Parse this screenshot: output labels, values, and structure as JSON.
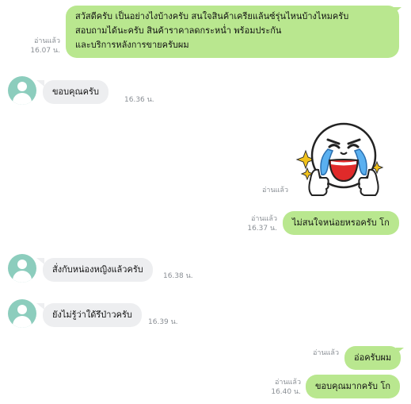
{
  "messages": {
    "m1": {
      "line1": "สวัสดีครับ เป็นอย่างไงบ้างครับ สนใจสินค้าเครียแล้นซ์รุ่นไหนบ้างไหมครับ",
      "line2": "สอบถามได้นะครับ สินค้าราคาลดกระหน่ำ พร้อมประกัน",
      "line3": "และบริการหลังการขายครับผม",
      "read": "อ่านแล้ว",
      "time": "16.07 น."
    },
    "m2": {
      "text": "ขอบคุณครับ",
      "time": "16.36 น."
    },
    "m3": {
      "sticker": "crying-laughing-moon-sticker",
      "read": "อ่านแล้ว"
    },
    "m4": {
      "text": "ไม่สนใจหน่อยหรอครับ โก",
      "read": "อ่านแล้ว",
      "time": "16.37 น."
    },
    "m5": {
      "text": "สั่งกับหน่องหญิงแล้วครับ",
      "time": "16.38 น."
    },
    "m6": {
      "text": "ยังไม่รู้ว่าใด้รึป่าวครับ",
      "time": "16.39 น."
    },
    "m7": {
      "text": "อ่อครับผม",
      "read": "อ่านแล้ว"
    },
    "m8": {
      "text": "ขอบคุณมากครับ โก",
      "read": "อ่านแล้ว",
      "time": "16.40 น."
    }
  },
  "colors": {
    "outgoing_bubble": "#b9e78f",
    "incoming_bubble": "#edeef0",
    "avatar": "#8ccdbd",
    "meta_text": "#8a8f95"
  }
}
